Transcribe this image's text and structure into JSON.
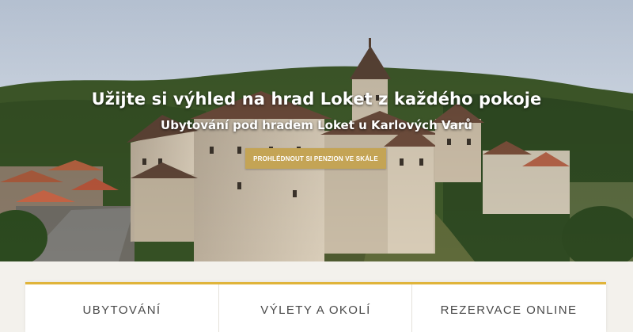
{
  "hero": {
    "headline_part1": "Užijte si výhled na hrad Loket z ",
    "headline_bold": "každého pokoje",
    "subtitle": "Ubytování pod hradem Loket u Karlových Varů",
    "cta_label": "PROHLÉDNOUT SI PENZION VE SKÁLE"
  },
  "sections": [
    {
      "label": "UBYTOVÁNÍ"
    },
    {
      "label": "VÝLETY A OKOLÍ"
    },
    {
      "label": "REZERVACE ONLINE"
    }
  ],
  "colors": {
    "accent": "#c4a455",
    "panel_border": "#e0b43a",
    "background": "#f3f1ec"
  }
}
